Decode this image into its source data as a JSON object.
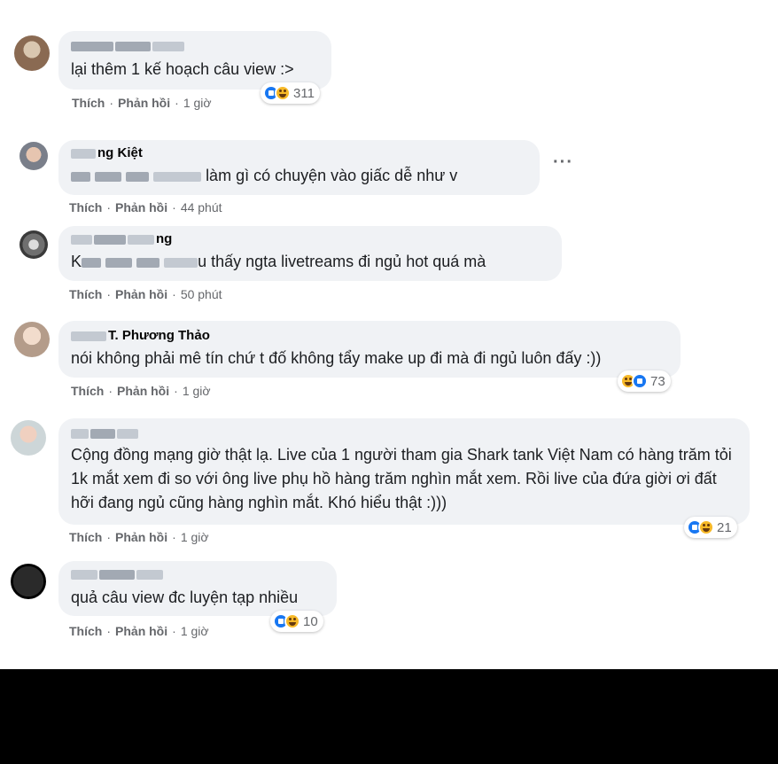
{
  "comments": [
    {
      "author_visible": "",
      "text": "lại thêm 1 kế hoạch câu view :>",
      "like_label": "Thích",
      "reply_label": "Phản hồi",
      "time": "1 giờ",
      "reaction_count": "311"
    },
    {
      "author_visible": "ng Kiệt",
      "text_visible": "làm   gì có chuyện vào giấc dễ như v",
      "like_label": "Thích",
      "reply_label": "Phản hồi",
      "time": "44 phút",
      "more_label": "···"
    },
    {
      "author_visible": "ng",
      "text_prefix": "K",
      "text_visible": "u thấy ngta livetreams đi ngủ hot quá mà",
      "like_label": "Thích",
      "reply_label": "Phản hồi",
      "time": "50 phút"
    },
    {
      "author_visible": "T. Phương Thảo",
      "text": "nói không phải mê tín chứ t đố không tẩy make up đi mà đi ngủ luôn đấy :))",
      "like_label": "Thích",
      "reply_label": "Phản hồi",
      "time": "1 giờ",
      "reaction_count": "73"
    },
    {
      "author_visible": "",
      "text": "Cộng đồng mạng giờ thật lạ. Live của 1 người tham gia Shark tank Việt Nam có hàng trăm tỏi 1k mắt xem đi so với ông live phụ hồ hàng trăm nghìn mắt xem. Rồi live của đứa giời ơi đất hỡi đang ngủ cũng hàng nghìn mắt. Khó hiểu thật :)))",
      "like_label": "Thích",
      "reply_label": "Phản hồi",
      "time": "1 giờ",
      "reaction_count": "21"
    },
    {
      "author_visible": "",
      "text": "quả câu view đc luyện tạp nhiều",
      "like_label": "Thích",
      "reply_label": "Phản hồi",
      "time": "1 giờ",
      "reaction_count": "10"
    }
  ],
  "icons": {
    "like": "like-reaction-icon",
    "haha": "haha-reaction-icon",
    "more": "more-options-icon"
  },
  "colors": {
    "bubble": "#f0f2f5",
    "meta": "#65676b",
    "like_blue": "#1877f2",
    "haha_yellow": "#f7b928"
  }
}
